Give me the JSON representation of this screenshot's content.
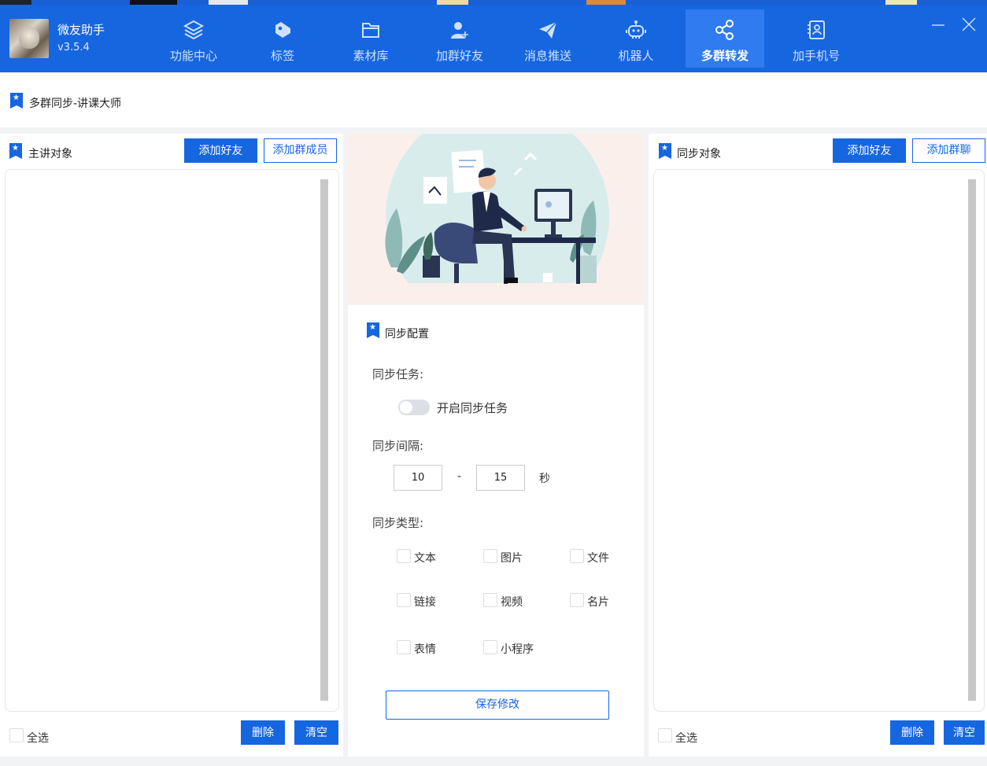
{
  "app": {
    "name": "微友助手",
    "version": "v3.5.4"
  },
  "nav": [
    {
      "label": "功能中心",
      "icon": "layers-icon"
    },
    {
      "label": "标签",
      "icon": "tag-icon"
    },
    {
      "label": "素材库",
      "icon": "folder-icon"
    },
    {
      "label": "加群好友",
      "icon": "add-user-icon"
    },
    {
      "label": "消息推送",
      "icon": "paper-plane-icon"
    },
    {
      "label": "机器人",
      "icon": "robot-icon"
    },
    {
      "label": "多群转发",
      "icon": "share-icon",
      "active": true
    },
    {
      "label": "加手机号",
      "icon": "contact-card-icon"
    }
  ],
  "page_title": "多群同步-讲课大师",
  "left_panel": {
    "title": "主讲对象",
    "add_friend": "添加好友",
    "add_member": "添加群成员",
    "select_all": "全选",
    "delete": "删除",
    "clear": "清空"
  },
  "right_panel": {
    "title": "同步对象",
    "add_friend": "添加好友",
    "add_group": "添加群聊",
    "select_all": "全选",
    "delete": "删除",
    "clear": "清空"
  },
  "config": {
    "title": "同步配置",
    "task_label": "同步任务:",
    "toggle_label": "开启同步任务",
    "toggle_on": false,
    "interval_label": "同步间隔:",
    "interval_min": "10",
    "interval_sep": "-",
    "interval_max": "15",
    "interval_unit": "秒",
    "type_label": "同步类型:",
    "types": [
      "文本",
      "图片",
      "文件",
      "链接",
      "视频",
      "名片",
      "表情",
      "小程序"
    ],
    "save": "保存修改"
  },
  "colors": {
    "brand": "#1666e0",
    "nav_active": "#2f7bef",
    "background": "#f2f3f5"
  }
}
